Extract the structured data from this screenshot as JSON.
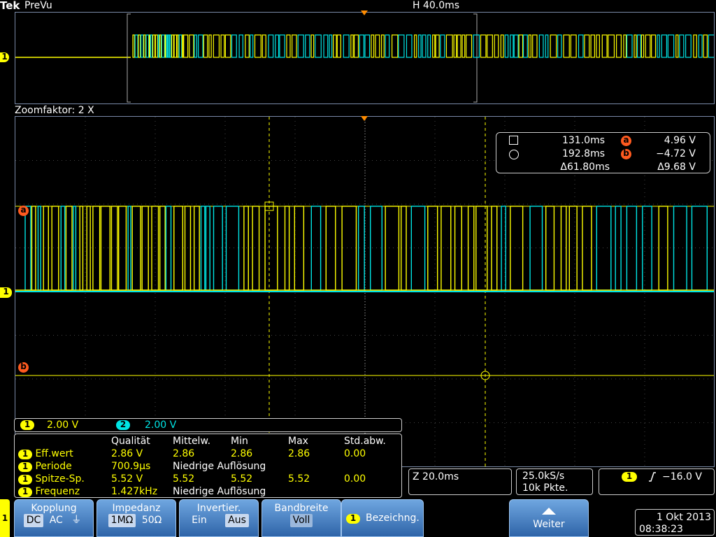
{
  "header": {
    "brand": "Tek",
    "mode": "PreVu",
    "horizontal": "H 40.0ms"
  },
  "zoom": {
    "label": "Zoomfaktor: 2 X"
  },
  "markers": {
    "ch1": "1",
    "ref_a": "a",
    "ref_b": "b"
  },
  "cursors": {
    "t1": "131.0ms",
    "t2": "192.8ms",
    "dt": "61.80ms",
    "va": "4.96 V",
    "vb": "−4.72 V",
    "dv": "9.68 V",
    "delta_symbol": "Δ"
  },
  "channels": [
    {
      "num": "1",
      "scale": "2.00 V",
      "color": "#ffff00"
    },
    {
      "num": "2",
      "scale": "2.00 V",
      "color": "#00e5e5"
    }
  ],
  "measurements": {
    "headers": [
      "Qualität",
      "Mittelw.",
      "Min",
      "Max",
      "Std.abw."
    ],
    "rows": [
      {
        "ch": "1",
        "name": "Eff.wert",
        "values": [
          "2.86 V",
          "2.86",
          "2.86",
          "2.86",
          "0.00"
        ]
      },
      {
        "ch": "1",
        "name": "Periode",
        "values": [
          "700.9µs",
          "Niedrige Auflösung",
          "",
          "",
          ""
        ]
      },
      {
        "ch": "1",
        "name": "Spitze-Sp.",
        "values": [
          "5.52 V",
          "5.52",
          "5.52",
          "5.52",
          "0.00"
        ]
      },
      {
        "ch": "1",
        "name": "Frequenz",
        "values": [
          "1.427kHz",
          "Niedrige Auflösung",
          "",
          "",
          ""
        ]
      }
    ]
  },
  "timebase": {
    "zoom": "Z 20.0ms",
    "rate": "25.0kS/s",
    "points": "10k Pkte."
  },
  "trigger": {
    "ch": "1",
    "slope_icon": "rising-edge-icon",
    "level": "−16.0 V"
  },
  "softkeys": {
    "side_marker": "1",
    "coupling": {
      "title": "Kopplung",
      "options": [
        "DC",
        "AC",
        "⏚"
      ]
    },
    "impedance": {
      "title": "Impedanz",
      "options": [
        "1MΩ",
        "50Ω"
      ]
    },
    "invert": {
      "title": "Invertier.",
      "options": [
        "Ein",
        "Aus"
      ]
    },
    "bandwidth": {
      "title": "Bandbreite",
      "value": "Voll"
    },
    "label": {
      "ch": "1",
      "title": "Bezeichng."
    },
    "more": {
      "title": "Weiter"
    }
  },
  "datetime": {
    "date": "1 Okt 2013",
    "time": "08:38:23"
  },
  "colors": {
    "ch1": "#ffff00",
    "ch2": "#00e5e5",
    "ref": "#ff5a1f",
    "frame": "#7a8aa8",
    "softkey": "#3c78c0"
  }
}
